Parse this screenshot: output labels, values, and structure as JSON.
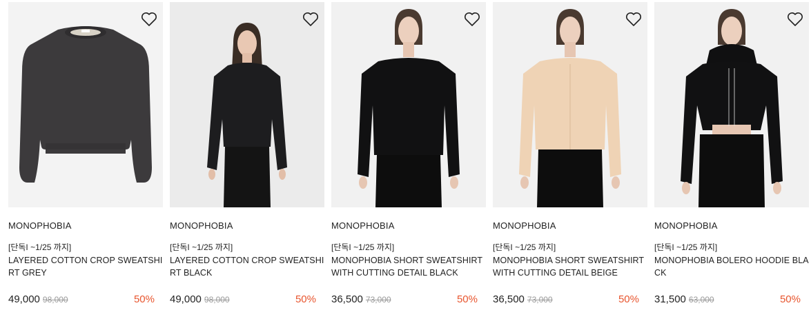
{
  "colors": {
    "discount": "#e8552e",
    "thumb_bg_flat": "#f2f2f2",
    "thumb_bg_studio": "#ececec"
  },
  "products": [
    {
      "brand": "MONOPHOBIA",
      "promo": "[단독I ~1/25 까지]",
      "name": "LAYERED COTTON CROP SWEATSHIRT GREY",
      "price": "49,000",
      "original_price": "98,000",
      "discount": "50%",
      "image": "grey-crop-sweatshirt-flat"
    },
    {
      "brand": "MONOPHOBIA",
      "promo": "[단독I ~1/25 까지]",
      "name": "LAYERED COTTON CROP SWEATSHIRT BLACK",
      "price": "49,000",
      "original_price": "98,000",
      "discount": "50%",
      "image": "model-black-crop-sweatshirt"
    },
    {
      "brand": "MONOPHOBIA",
      "promo": "[단독I ~1/25 까지]",
      "name": "MONOPHOBIA SHORT SWEATSHIRT WITH CUTTING DETAIL BLACK",
      "price": "36,500",
      "original_price": "73,000",
      "discount": "50%",
      "image": "model-black-short-sweatshirt"
    },
    {
      "brand": "MONOPHOBIA",
      "promo": "[단독I ~1/25 까지]",
      "name": "MONOPHOBIA SHORT SWEATSHIRT WITH CUTTING DETAIL BEIGE",
      "price": "36,500",
      "original_price": "73,000",
      "discount": "50%",
      "image": "model-beige-short-sweatshirt"
    },
    {
      "brand": "MONOPHOBIA",
      "promo": "[단독I ~1/25 까지]",
      "name": "MONOPHOBIA BOLERO HOODIE BLACK",
      "price": "31,500",
      "original_price": "63,000",
      "discount": "50%",
      "image": "model-black-bolero-hoodie"
    }
  ]
}
